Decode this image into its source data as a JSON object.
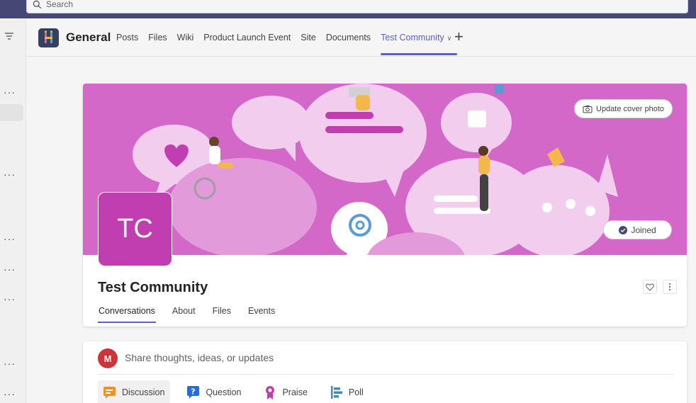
{
  "search": {
    "placeholder": "Search"
  },
  "channel": {
    "name": "General",
    "tabs": [
      {
        "label": "Posts"
      },
      {
        "label": "Files"
      },
      {
        "label": "Wiki"
      },
      {
        "label": "Product Launch Event"
      },
      {
        "label": "Site"
      },
      {
        "label": "Documents"
      },
      {
        "label": "Test Community"
      }
    ],
    "active_tab": "Test Community"
  },
  "community": {
    "initials": "TC",
    "name": "Test Community",
    "update_cover_label": "Update cover photo",
    "joined_label": "Joined",
    "tabs": [
      {
        "label": "Conversations"
      },
      {
        "label": "About"
      },
      {
        "label": "Files"
      },
      {
        "label": "Events"
      }
    ]
  },
  "composer": {
    "user_initial": "M",
    "prompt": "Share thoughts, ideas, or updates",
    "post_types": [
      {
        "label": "Discussion",
        "icon": "discussion-icon"
      },
      {
        "label": "Question",
        "icon": "question-icon"
      },
      {
        "label": "Praise",
        "icon": "praise-icon"
      },
      {
        "label": "Poll",
        "icon": "poll-icon"
      }
    ]
  },
  "colors": {
    "brand": "#5b5fc7",
    "top_bar": "#464775",
    "cover": "#d468c8",
    "community_avatar": "#c13eb0",
    "user_avatar": "#d13438"
  }
}
